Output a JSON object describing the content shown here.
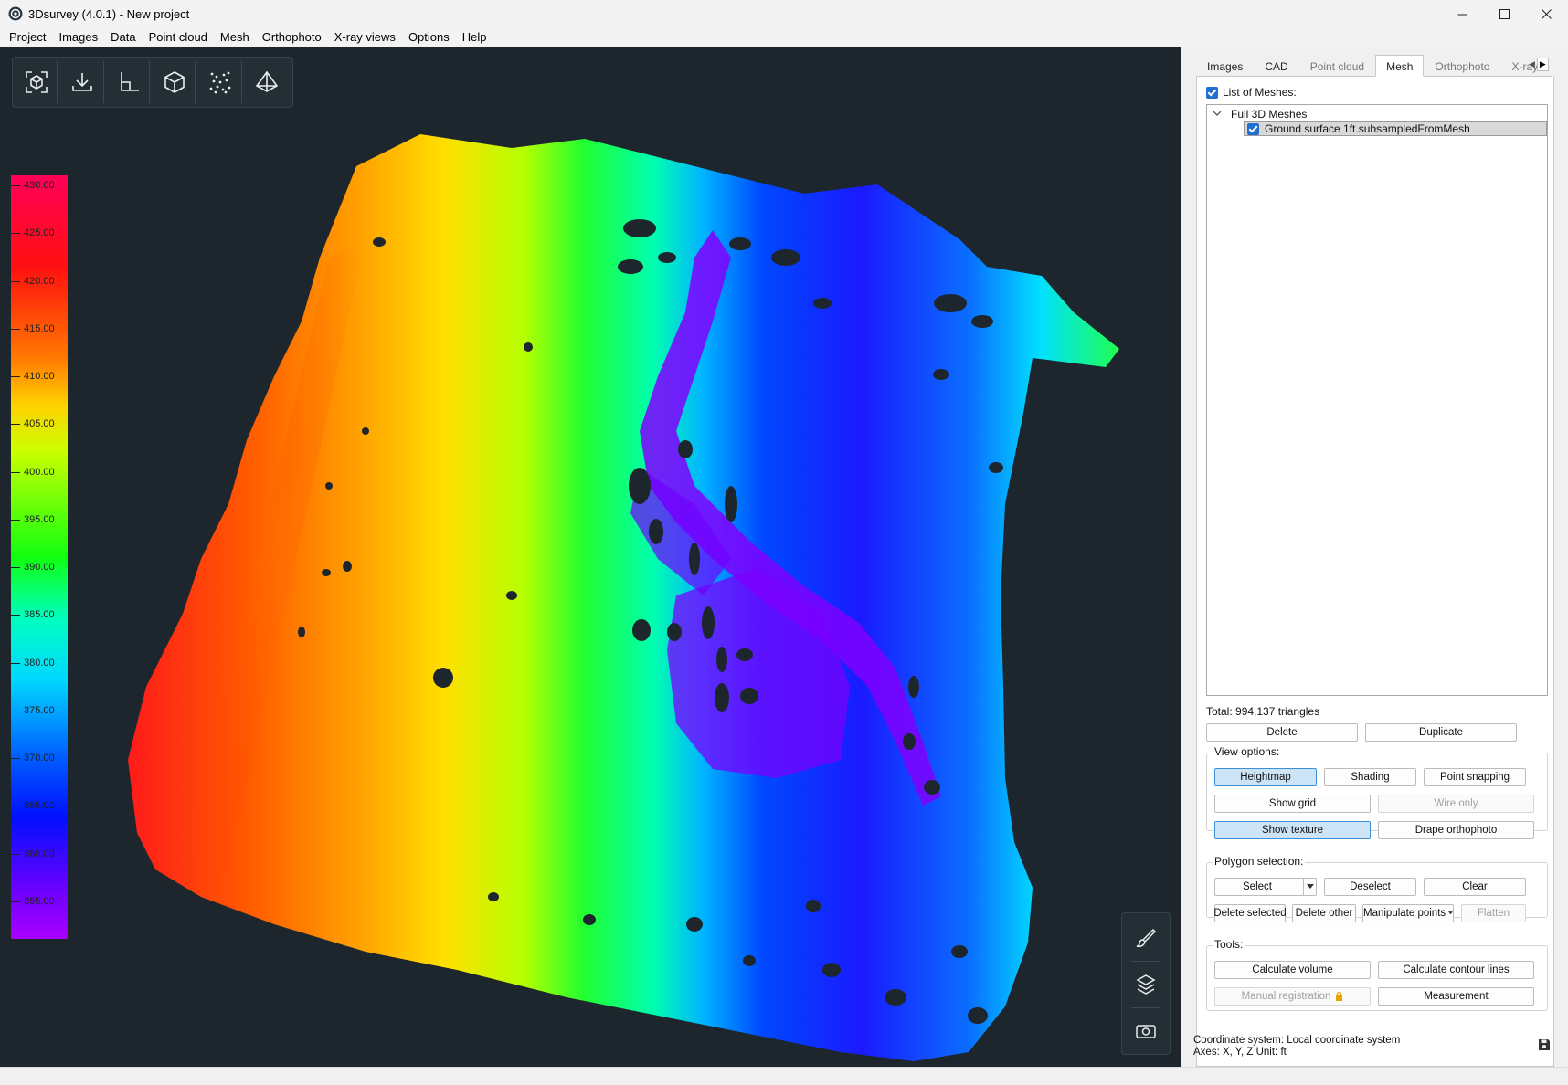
{
  "window": {
    "title": "3Dsurvey (4.0.1) - New project",
    "controls": [
      "minimize-icon",
      "maximize-icon",
      "close-icon"
    ]
  },
  "menu": [
    "Project",
    "Images",
    "Data",
    "Point cloud",
    "Mesh",
    "Orthophoto",
    "X-ray views",
    "Options",
    "Help"
  ],
  "toolbar": {
    "icons": [
      "focus-view-icon",
      "download-icon",
      "axes-icon",
      "cube-icon",
      "point-scatter-icon",
      "pyramid-icon"
    ]
  },
  "legend": {
    "labels": [
      "430.00",
      "425.00",
      "420.00",
      "415.00",
      "410.00",
      "405.00",
      "400.00",
      "395.00",
      "390.00",
      "385.00",
      "380.00",
      "375.00",
      "370.00",
      "365.00",
      "360.00",
      "355.00"
    ],
    "max": 430,
    "min": 350
  },
  "side_tools": [
    "brush-icon",
    "layers-icon",
    "camera-icon"
  ],
  "tabs": [
    {
      "label": "Images",
      "active": false,
      "dim": false
    },
    {
      "label": "CAD",
      "active": false,
      "dim": false
    },
    {
      "label": "Point cloud",
      "active": false,
      "dim": true
    },
    {
      "label": "Mesh",
      "active": true,
      "dim": false
    },
    {
      "label": "Orthophoto",
      "active": false,
      "dim": true
    },
    {
      "label": "X-ray view",
      "active": false,
      "dim": true
    }
  ],
  "mesh_panel": {
    "list_label": "List of Meshes:",
    "group_label": "Full 3D Meshes",
    "item_label": "Ground surface 1ft.subsampledFromMesh",
    "total": "Total: 994,137 triangles",
    "delete": "Delete",
    "duplicate": "Duplicate",
    "view_options": {
      "title": "View options:",
      "heightmap": "Heightmap",
      "shading": "Shading",
      "point_snapping": "Point snapping",
      "show_grid": "Show grid",
      "wire_only": "Wire only",
      "show_texture": "Show texture",
      "drape_orthophoto": "Drape orthophoto"
    },
    "polygon_selection": {
      "title": "Polygon selection:",
      "select": "Select",
      "deselect": "Deselect",
      "clear": "Clear",
      "delete_selected": "Delete selected",
      "delete_other": "Delete other",
      "manipulate_points": "Manipulate points",
      "flatten": "Flatten"
    },
    "tools": {
      "title": "Tools:",
      "calculate_volume": "Calculate volume",
      "calculate_contour_lines": "Calculate contour lines",
      "manual_registration": "Manual registration",
      "measurement": "Measurement"
    }
  },
  "status": {
    "coordinate_system": "Coordinate system: Local coordinate system",
    "axes": "Axes: X, Y, Z Unit: ft"
  }
}
